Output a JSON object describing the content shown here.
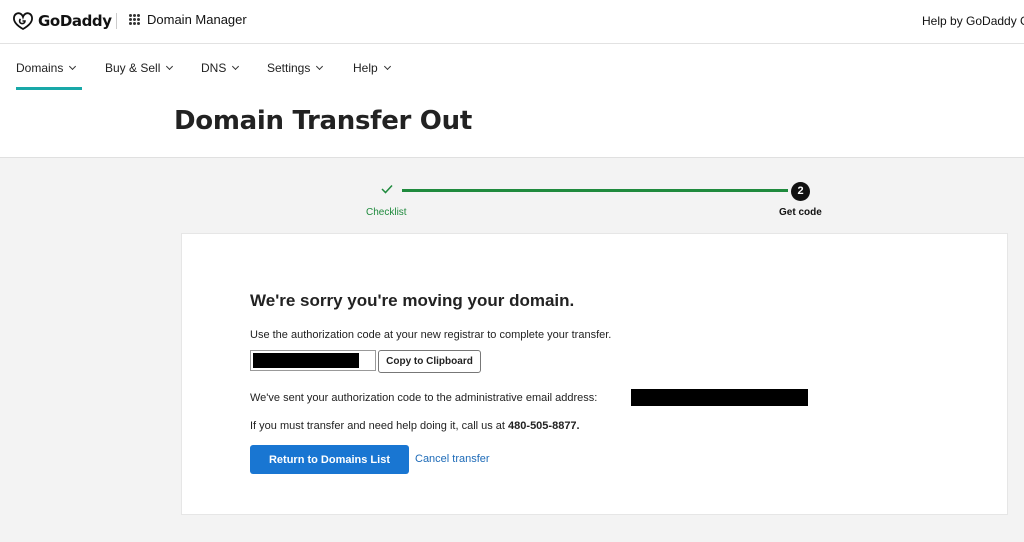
{
  "header": {
    "brand": "GoDaddy",
    "app_title": "Domain Manager",
    "help_link": "Help by GoDaddy G"
  },
  "nav": {
    "items": [
      {
        "label": "Domains"
      },
      {
        "label": "Buy & Sell"
      },
      {
        "label": "DNS"
      },
      {
        "label": "Settings"
      },
      {
        "label": "Help"
      }
    ],
    "active": "Domains"
  },
  "page": {
    "title": "Domain Transfer Out"
  },
  "stepper": {
    "steps": [
      {
        "label": "Checklist",
        "status": "complete"
      },
      {
        "label": "Get code",
        "number": "2",
        "status": "current"
      }
    ]
  },
  "card": {
    "heading": "We're sorry you're moving your domain.",
    "instruction": "Use the authorization code at your new registrar to complete your transfer.",
    "copy_button": "Copy to Clipboard",
    "sent_text": "We've sent your authorization code to the administrative email address:",
    "call_text": "If you must transfer and need help doing it, call us at",
    "phone": "480-505-8877.",
    "return_button": "Return to Domains List",
    "cancel_link": "Cancel transfer"
  },
  "colors": {
    "accent_green": "#1f8a3d",
    "nav_underline": "#18a8a8",
    "primary_button": "#1976d2",
    "link": "#1e6bb8"
  }
}
